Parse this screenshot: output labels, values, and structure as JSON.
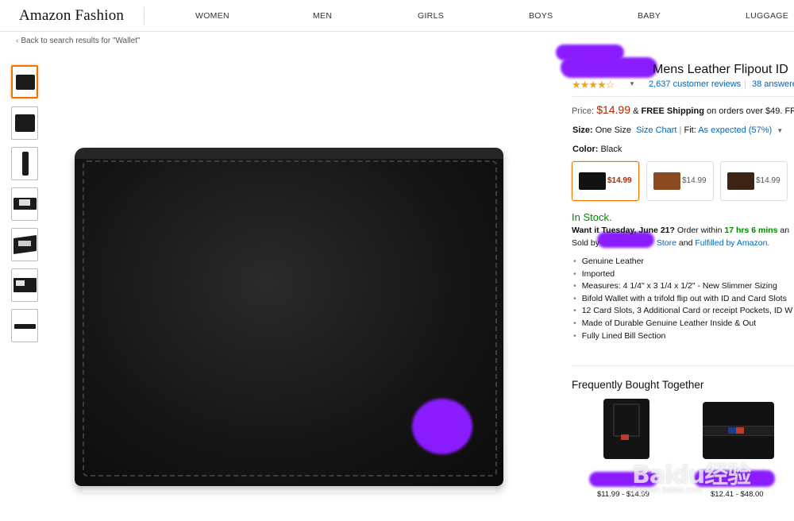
{
  "header": {
    "logo": "Amazon Fashion",
    "nav": [
      "WOMEN",
      "MEN",
      "GIRLS",
      "BOYS",
      "BABY",
      "LUGGAGE"
    ]
  },
  "back_link": "Back to search results for \"Wallet\"",
  "gallery": {
    "thumbnails": [
      "wallet-front",
      "wallet-back",
      "wallet-side",
      "wallet-open",
      "wallet-flipout",
      "wallet-id-window",
      "wallet-profile"
    ],
    "selected_index": 0
  },
  "product": {
    "title_visible": "Mens Leather Flipout ID",
    "rating_stars": "★★★★☆",
    "rating_value": 4.5,
    "reviews_link": "2,637 customer reviews",
    "separator": "|",
    "answered_link": "38 answere",
    "price_label": "Price:",
    "price": "$14.99",
    "shipping_prefix": "&",
    "shipping": "FREE Shipping",
    "shipping_suffix": "on orders over $49. FR",
    "size_label": "Size:",
    "size_value": "One Size",
    "size_chart": "Size Chart",
    "fit_separator": "|",
    "fit_label": "Fit:",
    "fit_value": "As expected (57%)",
    "color_label": "Color:",
    "color_value": "Black",
    "swatches": [
      {
        "name": "black",
        "price": "$14.99",
        "color": "#111111"
      },
      {
        "name": "tan",
        "price": "$14.99",
        "color": "#8b4a22"
      },
      {
        "name": "brown",
        "price": "$14.99",
        "color": "#3b2416"
      }
    ],
    "availability": "In Stock.",
    "delivery_prefix": "Want it Tuesday, June 21?",
    "delivery_mid": "Order within",
    "delivery_time": "17 hrs 6 mins",
    "delivery_suffix": "an",
    "sold_prefix": "Sold by",
    "sold_store": "Store",
    "sold_and": "and",
    "sold_fulfilled": "Fulfilled by Amazon.",
    "bullets": [
      "Genuine Leather",
      "Imported",
      "Measures: 4 1/4\" x 3 1/4 x 1/2\" - New Slimmer Sizing",
      "Bifold Wallet with a trifold flip out with ID and Card Slots",
      "12 Card Slots, 3 Additional Card or receipt Pockets, ID W",
      "Made of Durable Genuine Leather Inside & Out",
      "Fully Lined Bill Section"
    ]
  },
  "fbt": {
    "title": "Frequently Bought Together",
    "items": [
      {
        "name": "money-clip-card-holder",
        "price": "$11.99 - $14.99"
      },
      {
        "name": "bifold-wallet",
        "price": "$12.41 - $48.00"
      }
    ]
  },
  "watermark": {
    "brand": "Baidu经验",
    "url": "jingyan.baidu.com"
  },
  "colors": {
    "link": "#0066c0",
    "price": "#b12704",
    "in_stock": "#008a00",
    "selected_border": "#e77600",
    "star": "#f0a41c",
    "redaction": "#8a1cff"
  }
}
